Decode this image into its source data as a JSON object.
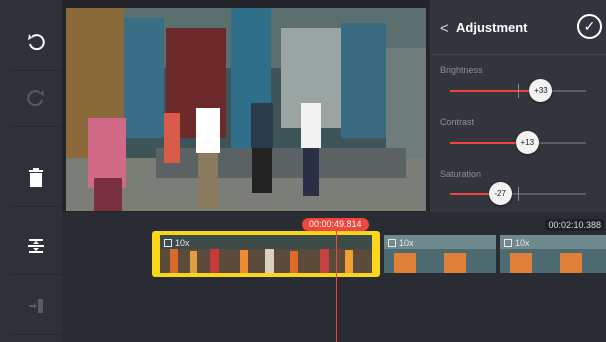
{
  "toolbar": {
    "undo_icon": "undo-icon",
    "redo_icon": "redo-icon",
    "delete_icon": "trash-icon",
    "split_icon": "split-vertical-icon",
    "export_icon": "import-arrow-icon"
  },
  "adjustment": {
    "title": "Adjustment",
    "back_glyph": "<",
    "confirm_icon": "check-circle-icon",
    "sliders": [
      {
        "label": "Brightness",
        "value": "+33",
        "level": 0.665
      },
      {
        "label": "Contrast",
        "value": "+13",
        "level": 0.565
      },
      {
        "label": "Saturation",
        "value": "-27",
        "level": 0.365
      }
    ]
  },
  "timeline": {
    "current_time": "00:00:49.814",
    "total_time": "00:02:10.388",
    "clips": [
      {
        "speed": "10x",
        "selected": true
      },
      {
        "speed": "10x",
        "selected": false
      },
      {
        "speed": "10x",
        "selected": false
      }
    ]
  },
  "colors": {
    "accent": "#f0443c",
    "selection": "#f7d61c",
    "panel": "#33353c"
  }
}
